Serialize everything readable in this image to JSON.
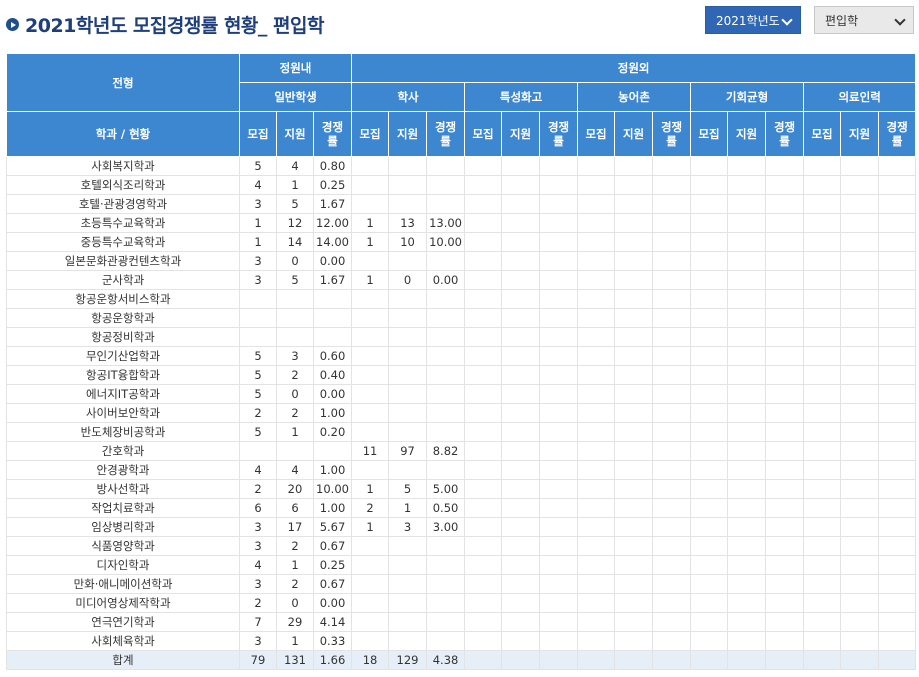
{
  "page": {
    "title": "2021학년도 모집경쟁률 현황_ 편입학"
  },
  "controls": {
    "year_select": "2021학년도",
    "type_select": "편입학"
  },
  "table": {
    "header": {
      "track": "전형",
      "in_quota": "정원내",
      "out_quota": "정원외",
      "general": "일반학생",
      "bachelor": "학사",
      "special_hs": "특성화고",
      "rural": "농어촌",
      "equal_opp": "기회균형",
      "medical": "의료인력",
      "dept_status": "학과 / 현황",
      "col_recruit": "모집",
      "col_apply": "지원",
      "col_ratio": "경쟁률"
    },
    "rows": [
      [
        "사회복지학과",
        "5",
        "4",
        "0.80",
        "",
        "",
        ""
      ],
      [
        "호텔외식조리학과",
        "4",
        "1",
        "0.25",
        "",
        "",
        ""
      ],
      [
        "호텔·관광경영학과",
        "3",
        "5",
        "1.67",
        "",
        "",
        ""
      ],
      [
        "초등특수교육학과",
        "1",
        "12",
        "12.00",
        "1",
        "13",
        "13.00"
      ],
      [
        "중등특수교육학과",
        "1",
        "14",
        "14.00",
        "1",
        "10",
        "10.00"
      ],
      [
        "일본문화관광컨텐츠학과",
        "3",
        "0",
        "0.00",
        "",
        "",
        ""
      ],
      [
        "군사학과",
        "3",
        "5",
        "1.67",
        "1",
        "0",
        "0.00"
      ],
      [
        "항공운항서비스학과",
        "",
        "",
        "",
        "",
        "",
        ""
      ],
      [
        "항공운항학과",
        "",
        "",
        "",
        "",
        "",
        ""
      ],
      [
        "항공정비학과",
        "",
        "",
        "",
        "",
        "",
        ""
      ],
      [
        "무인기산업학과",
        "5",
        "3",
        "0.60",
        "",
        "",
        ""
      ],
      [
        "항공IT융합학과",
        "5",
        "2",
        "0.40",
        "",
        "",
        ""
      ],
      [
        "에너지IT공학과",
        "5",
        "0",
        "0.00",
        "",
        "",
        ""
      ],
      [
        "사이버보안학과",
        "2",
        "2",
        "1.00",
        "",
        "",
        ""
      ],
      [
        "반도체장비공학과",
        "5",
        "1",
        "0.20",
        "",
        "",
        ""
      ],
      [
        "간호학과",
        "",
        "",
        "",
        "11",
        "97",
        "8.82"
      ],
      [
        "안경광학과",
        "4",
        "4",
        "1.00",
        "",
        "",
        ""
      ],
      [
        "방사선학과",
        "2",
        "20",
        "10.00",
        "1",
        "5",
        "5.00"
      ],
      [
        "작업치료학과",
        "6",
        "6",
        "1.00",
        "2",
        "1",
        "0.50"
      ],
      [
        "임상병리학과",
        "3",
        "17",
        "5.67",
        "1",
        "3",
        "3.00"
      ],
      [
        "식품영양학과",
        "3",
        "2",
        "0.67",
        "",
        "",
        ""
      ],
      [
        "디자인학과",
        "4",
        "1",
        "0.25",
        "",
        "",
        ""
      ],
      [
        "만화·애니메이션학과",
        "3",
        "2",
        "0.67",
        "",
        "",
        ""
      ],
      [
        "미디어영상제작학과",
        "2",
        "0",
        "0.00",
        "",
        "",
        ""
      ],
      [
        "연극연기학과",
        "7",
        "29",
        "4.14",
        "",
        "",
        ""
      ],
      [
        "사회체육학과",
        "3",
        "1",
        "0.33",
        "",
        "",
        ""
      ]
    ],
    "total": [
      "합계",
      "79",
      "131",
      "1.66",
      "18",
      "129",
      "4.38"
    ]
  }
}
